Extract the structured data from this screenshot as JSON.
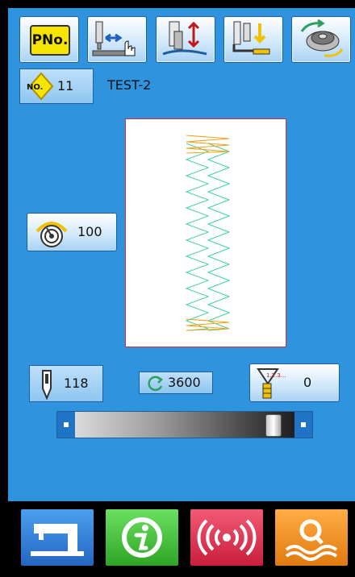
{
  "toolbar": {
    "pattern_no_label": "PNo.",
    "icons": [
      "pattern-number-icon",
      "needle-move-icon",
      "presser-up-down-icon",
      "presser-down-icon",
      "bobbin-winding-icon"
    ]
  },
  "pattern": {
    "no_badge": "NO.",
    "number": "11",
    "name": "TEST-2"
  },
  "speed": {
    "value": "100"
  },
  "status": {
    "stitch_count": "118",
    "spm": "3600",
    "counter_value": "0",
    "counter_badge": "1.2.3..."
  },
  "slider": {
    "position_fraction": 0.93
  },
  "bottom_nav": {
    "items": [
      "sewing-mode",
      "information",
      "communication",
      "search"
    ]
  },
  "colors": {
    "screen_bg": "#2f93de",
    "zigzag_main": "#3fd1a0",
    "zigzag_end": "#f2a31c",
    "preview_border": "#c0364a",
    "nav_sew": "#2f7fd9",
    "nav_info": "#46c33a",
    "nav_comm": "#e0334f",
    "nav_search": "#f08c1c"
  }
}
